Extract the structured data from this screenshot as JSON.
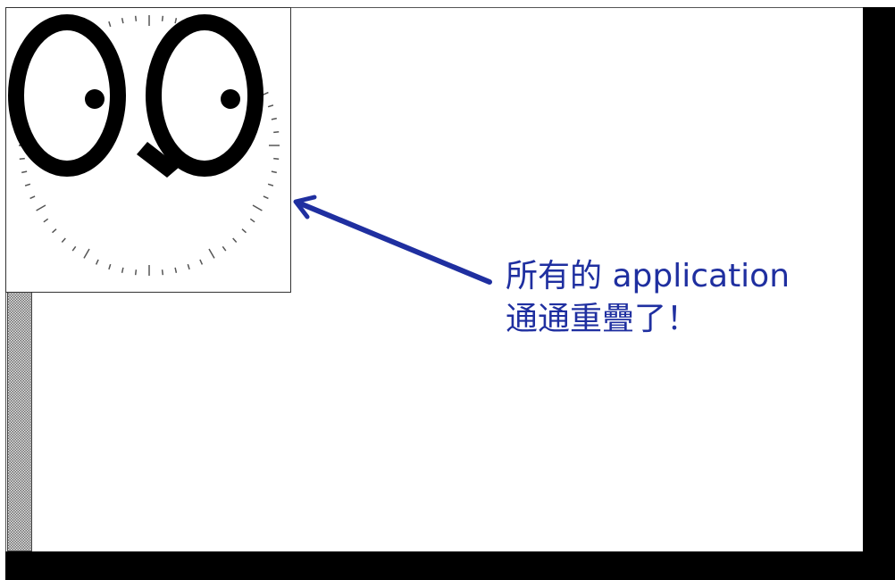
{
  "screen": {
    "description_colors": {
      "desktop": "#ffffff",
      "frame": "#000000",
      "annotation": "#1f2fa0",
      "arrow": "#1f2fa0"
    }
  },
  "apps": {
    "xeyes": {
      "icon": "xeyes-eyes-icon"
    },
    "xclock": {
      "icon": "xclock-face-icon"
    },
    "xterm": {
      "icon": "xterm-strip"
    }
  },
  "annotation": {
    "line1": "所有的 application",
    "line2": "通通重疊了！"
  }
}
